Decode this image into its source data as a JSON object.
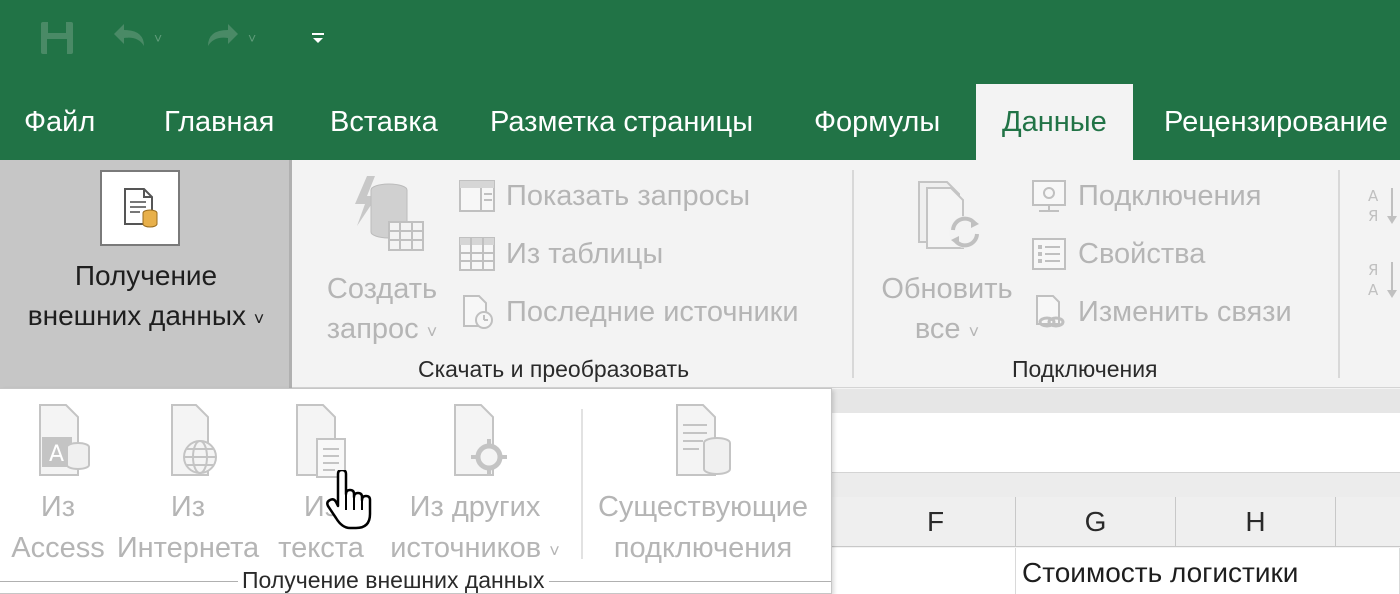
{
  "colors": {
    "accent": "#217346",
    "disabled_text": "#b5b5b5"
  },
  "qat": {
    "save_icon": "save-icon",
    "undo_icon": "undo-icon",
    "redo_icon": "redo-icon",
    "customize_icon": "customize-qat-icon"
  },
  "tabs": [
    {
      "label": "Файл",
      "active": false
    },
    {
      "label": "Главная",
      "active": false
    },
    {
      "label": "Вставка",
      "active": false
    },
    {
      "label": "Разметка страницы",
      "active": false
    },
    {
      "label": "Формулы",
      "active": false
    },
    {
      "label": "Данные",
      "active": true
    },
    {
      "label": "Рецензирование",
      "active": false
    }
  ],
  "ribbon": {
    "get_external": {
      "line1": "Получение",
      "line2": "внешних данных",
      "caret": "˅"
    },
    "create_query": {
      "line1": "Создать",
      "line2": "запрос",
      "caret": "˅"
    },
    "show_queries": "Показать запросы",
    "from_table": "Из таблицы",
    "recent_sources": "Последние источники",
    "group_transform": "Скачать и преобразовать",
    "refresh_all": {
      "line1": "Обновить",
      "line2": "все",
      "caret": "˅"
    },
    "connections": "Подключения",
    "properties": "Свойства",
    "edit_links": "Изменить связи",
    "group_connections": "Подключения"
  },
  "dropdown": {
    "from_access": {
      "line1": "Из",
      "line2": "Access"
    },
    "from_web": {
      "line1": "Из",
      "line2": "Интернета"
    },
    "from_text": {
      "line1": "Из",
      "line2": "текста"
    },
    "from_other": {
      "line1": "Из других",
      "line2": "источников",
      "caret": "˅"
    },
    "existing": {
      "line1": "Существующие",
      "line2": "подключения"
    },
    "group_label": "Получение внешних данных"
  },
  "grid": {
    "columns": [
      "F",
      "G",
      "H"
    ],
    "row1_cell": "Стоимость логистики"
  }
}
